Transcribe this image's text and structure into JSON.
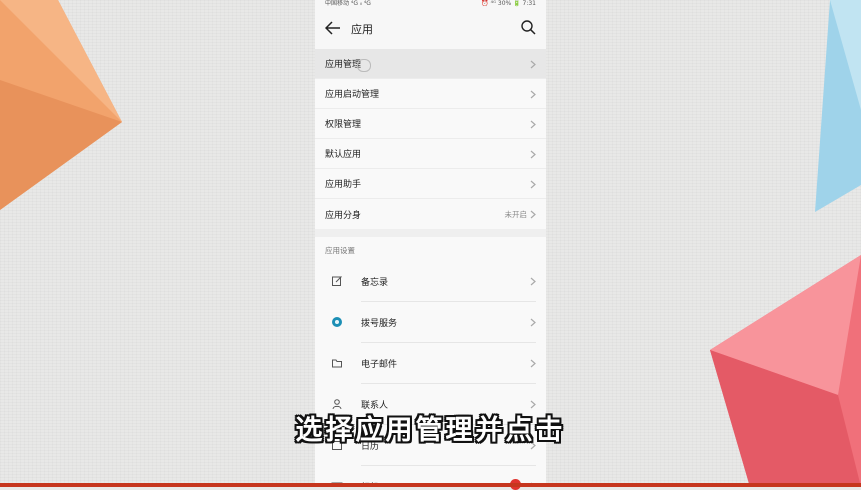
{
  "status_bar": {
    "left": "中国移动 ⁴G ᵢₗ ⁴G",
    "right": "⏰ ⁴ᴳ 30% 🔋 7:31"
  },
  "header": {
    "title": "应用"
  },
  "menu": [
    {
      "label": "应用管理",
      "value": ""
    },
    {
      "label": "应用启动管理",
      "value": ""
    },
    {
      "label": "权限管理",
      "value": ""
    },
    {
      "label": "默认应用",
      "value": ""
    },
    {
      "label": "应用助手",
      "value": ""
    },
    {
      "label": "应用分身",
      "value": "未开启"
    }
  ],
  "section": {
    "title": "应用设置"
  },
  "apps": [
    {
      "label": "备忘录",
      "icon": "memo-icon"
    },
    {
      "label": "拨号服务",
      "icon": "dialer-icon"
    },
    {
      "label": "电子邮件",
      "icon": "email-icon"
    },
    {
      "label": "联系人",
      "icon": "contacts-icon"
    },
    {
      "label": "日历",
      "icon": "calendar-icon"
    },
    {
      "label": "相机",
      "icon": "camera-icon"
    }
  ],
  "caption": "选择应用管理并点击",
  "colors": {
    "accent_bar": "#c6361e",
    "dialer_blue": "#1c8fb5"
  }
}
